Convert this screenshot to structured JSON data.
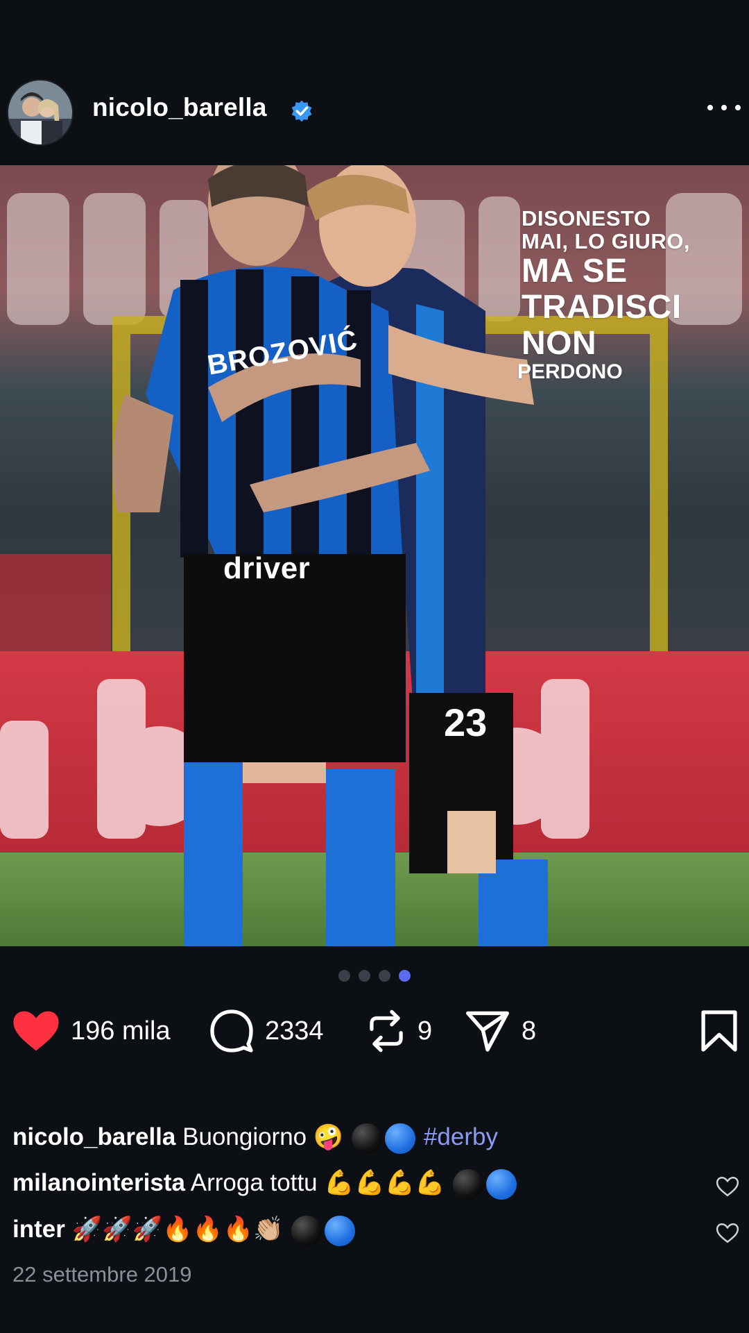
{
  "post": {
    "username": "nicolo_barella",
    "verified": true,
    "image_overlay": {
      "line1": "DISONESTO",
      "line2": "MAI, LO GIURO,",
      "line3": "MA SE",
      "line4": "TRADISCI",
      "line5": "NON",
      "line6": "PERDONO"
    },
    "photo_text": {
      "jersey_name": "BROZOVIĆ",
      "sponsor": "driver",
      "number": "23"
    },
    "carousel": {
      "total": 4,
      "active": 4
    }
  },
  "actions": {
    "likes": "196 mila",
    "comments": "2334",
    "reposts": "9",
    "shares": "8"
  },
  "captions": [
    {
      "username": "nicolo_barella",
      "text": "Buongiorno",
      "emojis": "🤪",
      "hashtag": "#derby"
    },
    {
      "username": "milanointerista",
      "text": "Arroga tottu",
      "emojis": "💪💪💪💪"
    },
    {
      "username": "inter",
      "text": "",
      "emojis": "🚀🚀🚀🔥🔥🔥👏🏼"
    }
  ],
  "date": "22 settembre 2019",
  "colors": {
    "background": "#0c0f14",
    "like_red": "#ff3040",
    "hashtag": "#8c9bf2",
    "verified_blue": "#3897f0",
    "dot_active": "#5b6cf0"
  }
}
